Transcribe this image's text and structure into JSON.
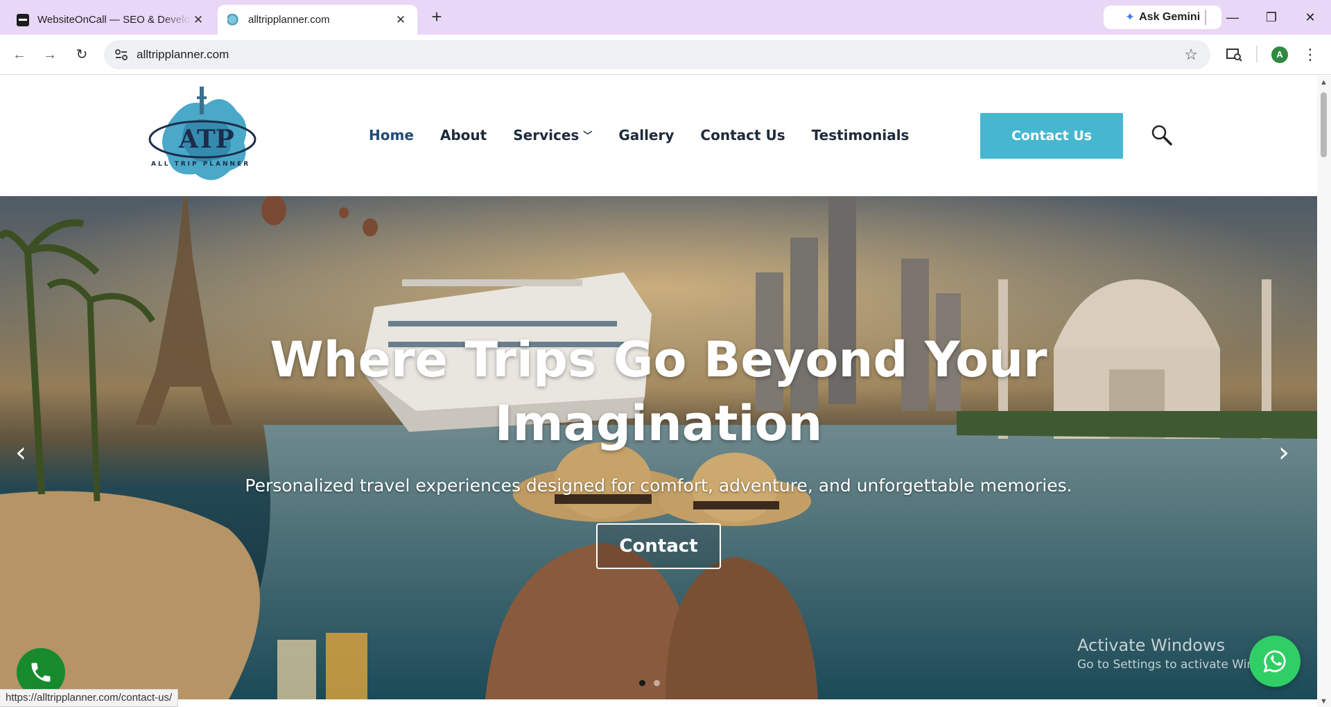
{
  "browser": {
    "tabs": [
      {
        "title": "WebsiteOnCall — SEO & Development",
        "active": false
      },
      {
        "title": "alltripplanner.com",
        "active": true
      }
    ],
    "gemini_label": "Ask Gemini",
    "url": "alltripplanner.com",
    "profile_initial": "A",
    "status_url": "https://alltripplanner.com/contact-us/"
  },
  "site": {
    "logo_text": "ATP",
    "logo_subtext": "ALL TRIP PLANNER",
    "menu": [
      {
        "label": "Home"
      },
      {
        "label": "About"
      },
      {
        "label": "Services"
      },
      {
        "label": "Gallery"
      },
      {
        "label": "Contact Us"
      },
      {
        "label": "Testimonials"
      }
    ],
    "header_button": "Contact Us"
  },
  "hero": {
    "title_line1": "Where Trips Go Beyond Your",
    "title_line2": "Imagination",
    "subtitle": "Personalized travel experiences designed for comfort, adventure, and unforgettable memories.",
    "button": "Contact",
    "slide_count": 2,
    "active_slide": 1
  },
  "overlay": {
    "activate_title": "Activate Windows",
    "activate_sub": "Go to Settings to activate Windows."
  },
  "colors": {
    "tabbar": "#e9d7f7",
    "accent_button": "#45b8d0",
    "menu_text": "#1d2a3a",
    "whatsapp": "#2fcf65",
    "phone": "#168a2c"
  }
}
